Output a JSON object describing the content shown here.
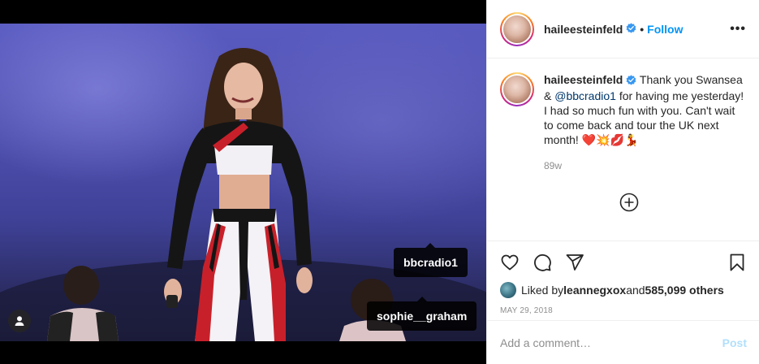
{
  "post": {
    "username": "haileesteinfeld",
    "follow_label": "Follow",
    "separator": "•",
    "more_label": "•••",
    "caption": {
      "username": "haileesteinfeld",
      "text_1": " Thank you Swansea & ",
      "mention": "@bbcradio1",
      "text_2": " for having me yesterday! I had so much fun with you. Can't wait to come back and tour the UK next month! ",
      "emojis": "❤️💥💋💃"
    },
    "time_ago": "89w",
    "likes": {
      "prefix": "Liked by ",
      "liker": "leannegxox",
      "middle": " and ",
      "count": "585,099 others"
    },
    "date": "MAY 29, 2018",
    "comment_placeholder": "Add a comment…",
    "post_label": "Post"
  },
  "photo_tags": {
    "tag_1": "bbcradio1",
    "tag_2": "sophie__graham"
  },
  "icons": {
    "verified": "verified-badge-icon",
    "more": "more-options-icon",
    "add": "add-circle-icon",
    "like": "heart-icon",
    "comment": "comment-icon",
    "share": "share-icon",
    "save": "bookmark-icon",
    "user_tags": "user-tags-icon"
  },
  "colors": {
    "link_blue": "#0095f6",
    "mention": "#00376b",
    "muted": "#8e8e8e",
    "post_disabled": "#b2dffc"
  }
}
